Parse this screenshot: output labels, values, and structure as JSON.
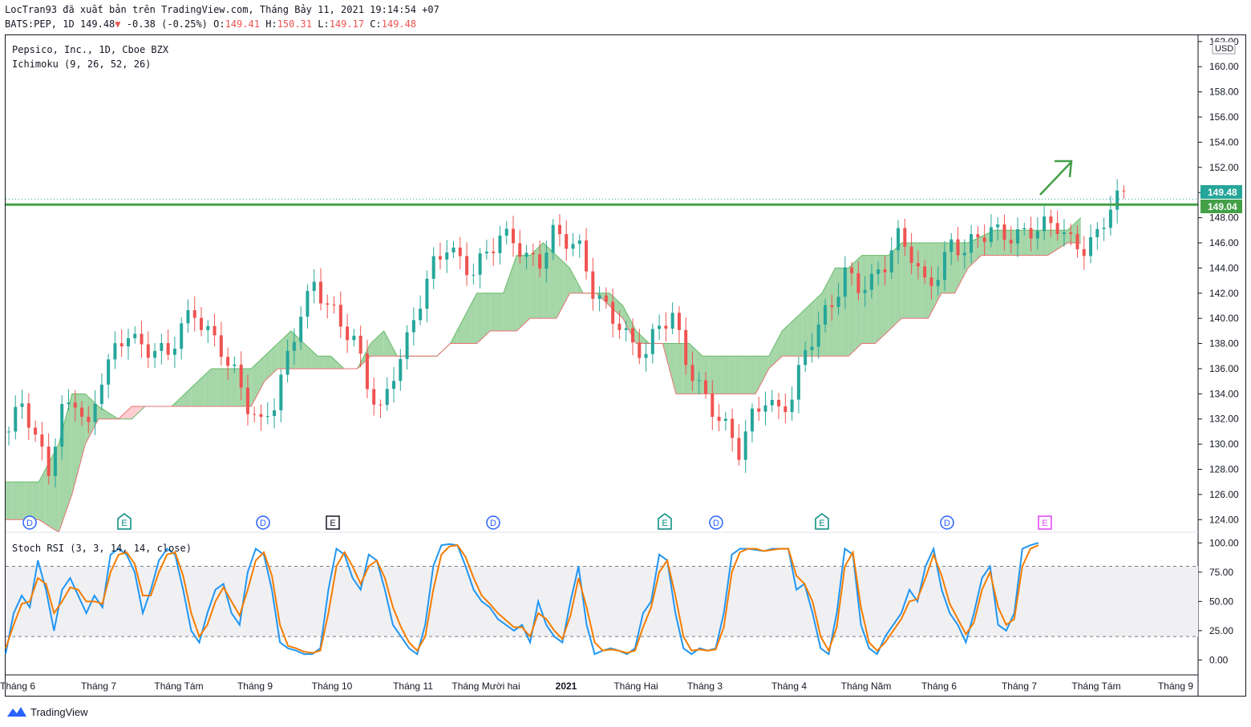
{
  "header": {
    "line1": "LocTran93 đã xuất bản trên TradingView.com, Tháng Bảy 11, 2021 19:14:54 +07",
    "symbol": "BATS:PEP, 1D",
    "last": "149.48",
    "change_arrow": "▼",
    "change": "-0.38 (-0.25%)",
    "o_label": "O:",
    "o_value": "149.41",
    "h_label": "H:",
    "h_value": "150.31",
    "l_label": "L:",
    "l_value": "149.17",
    "c_label": "C:",
    "c_value": "149.48"
  },
  "legend": {
    "title": "Pepsico, Inc., 1D, Cboe BZX",
    "indicator": "Ichimoku (9, 26, 52, 26)",
    "stoch": "Stoch RSI (3, 3, 14, 14, close)"
  },
  "currency": "USD",
  "price_tags": {
    "last": "149.48",
    "level": "149.04"
  },
  "colors": {
    "up": "#26a69a",
    "down": "#ef5350",
    "cloud_up": "#a5d6a7",
    "cloud_down": "#ffcdd2",
    "support": "#43a047",
    "k_line": "#2196f3",
    "d_line": "#f57c00"
  },
  "events": [
    {
      "label": "D",
      "kind": "dividend",
      "x_month": "Tháng 6"
    },
    {
      "label": "E",
      "kind": "earnings",
      "x_month": "Tháng 7"
    },
    {
      "label": "D",
      "kind": "dividend",
      "x_month": "Tháng 9"
    },
    {
      "label": "E",
      "kind": "earnings-dark",
      "x_month": "Tháng 10"
    },
    {
      "label": "D",
      "kind": "dividend",
      "x_month": "Tháng Mười hai"
    },
    {
      "label": "E",
      "kind": "earnings",
      "x_month": "Tháng Hai"
    },
    {
      "label": "D",
      "kind": "dividend",
      "x_month": "Tháng 3"
    },
    {
      "label": "E",
      "kind": "earnings",
      "x_month": "Tháng 4"
    },
    {
      "label": "D",
      "kind": "dividend",
      "x_month": "Tháng 6"
    },
    {
      "label": "E",
      "kind": "earnings-future",
      "x_month": "Tháng 7"
    }
  ],
  "footer": {
    "brand": "TradingView"
  },
  "chart_data": [
    {
      "type": "candlestick",
      "title": "Pepsico, Inc., 1D, Cboe BZX",
      "y_ticks": [
        "162.00",
        "160.00",
        "158.00",
        "156.00",
        "154.00",
        "152.00",
        "150.00",
        "148.00",
        "146.00",
        "144.00",
        "142.00",
        "140.00",
        "138.00",
        "136.00",
        "134.00",
        "132.00",
        "130.00",
        "128.00",
        "126.00",
        "124.00"
      ],
      "ylim": [
        123,
        162.5
      ],
      "x_ticks": [
        "Tháng 6",
        "Tháng 7",
        "Tháng Tám",
        "Tháng 9",
        "Tháng 10",
        "Tháng 11",
        "Tháng Mười hai",
        "2021",
        "Tháng Hai",
        "Tháng 3",
        "Tháng 4",
        "Tháng Năm",
        "Tháng 6",
        "Tháng 7",
        "Tháng Tám",
        "Tháng 9"
      ],
      "support_level": 149.04,
      "last_price": 149.48,
      "price_path": [
        [
          0,
          131
        ],
        [
          2,
          133
        ],
        [
          4,
          130
        ],
        [
          6,
          128
        ],
        [
          8,
          133
        ],
        [
          10,
          134
        ],
        [
          12,
          131
        ],
        [
          14,
          135
        ],
        [
          16,
          137
        ],
        [
          18,
          139
        ],
        [
          20,
          138
        ],
        [
          22,
          138
        ],
        [
          24,
          137
        ],
        [
          26,
          139
        ],
        [
          28,
          140
        ],
        [
          30,
          139
        ],
        [
          32,
          138
        ],
        [
          34,
          136
        ],
        [
          36,
          133
        ],
        [
          38,
          131
        ],
        [
          40,
          133
        ],
        [
          42,
          137
        ],
        [
          44,
          141
        ],
        [
          46,
          143
        ],
        [
          48,
          141
        ],
        [
          50,
          139
        ],
        [
          52,
          138
        ],
        [
          54,
          135
        ],
        [
          56,
          133
        ],
        [
          58,
          136
        ],
        [
          60,
          138
        ],
        [
          62,
          141
        ],
        [
          64,
          144
        ],
        [
          66,
          146
        ],
        [
          68,
          145
        ],
        [
          70,
          144
        ],
        [
          72,
          145
        ],
        [
          74,
          146
        ],
        [
          76,
          146
        ],
        [
          78,
          145
        ],
        [
          80,
          145
        ],
        [
          82,
          147
        ],
        [
          84,
          146
        ],
        [
          86,
          145
        ],
        [
          88,
          142
        ],
        [
          90,
          141
        ],
        [
          92,
          140
        ],
        [
          94,
          138
        ],
        [
          96,
          137
        ],
        [
          98,
          139
        ],
        [
          100,
          140
        ],
        [
          102,
          137
        ],
        [
          104,
          135
        ],
        [
          106,
          133
        ],
        [
          108,
          131
        ],
        [
          110,
          129
        ],
        [
          112,
          132
        ],
        [
          114,
          134
        ],
        [
          116,
          133
        ],
        [
          118,
          134
        ],
        [
          120,
          137
        ],
        [
          122,
          139
        ],
        [
          124,
          141
        ],
        [
          126,
          144
        ],
        [
          128,
          143
        ],
        [
          130,
          143
        ],
        [
          132,
          144
        ],
        [
          134,
          146
        ],
        [
          136,
          145
        ],
        [
          138,
          143
        ],
        [
          140,
          144
        ],
        [
          142,
          146
        ],
        [
          144,
          145
        ],
        [
          146,
          146
        ],
        [
          148,
          147
        ],
        [
          150,
          147
        ],
        [
          152,
          147
        ],
        [
          154,
          147
        ],
        [
          156,
          147
        ],
        [
          158,
          147
        ],
        [
          160,
          146
        ],
        [
          162,
          146
        ],
        [
          164,
          147
        ],
        [
          166,
          149
        ],
        [
          168,
          149.5
        ]
      ],
      "cloud_span_a": [
        [
          0,
          127
        ],
        [
          5,
          127
        ],
        [
          8,
          130
        ],
        [
          10,
          134
        ],
        [
          12,
          134
        ],
        [
          14,
          133
        ],
        [
          17,
          132
        ],
        [
          19,
          132
        ],
        [
          21,
          133
        ],
        [
          23,
          133
        ],
        [
          25,
          133
        ],
        [
          27,
          134
        ],
        [
          29,
          135
        ],
        [
          31,
          136
        ],
        [
          33,
          136
        ],
        [
          35,
          136
        ],
        [
          37,
          136
        ],
        [
          39,
          137
        ],
        [
          41,
          138
        ],
        [
          43,
          139
        ],
        [
          45,
          138
        ],
        [
          47,
          137
        ],
        [
          49,
          137
        ],
        [
          51,
          136
        ],
        [
          53,
          136
        ],
        [
          55,
          138
        ],
        [
          57,
          139
        ],
        [
          59,
          137
        ],
        [
          61,
          137
        ],
        [
          63,
          137
        ],
        [
          65,
          137
        ],
        [
          67,
          138
        ],
        [
          69,
          140
        ],
        [
          71,
          142
        ],
        [
          73,
          142
        ],
        [
          75,
          142
        ],
        [
          77,
          145
        ],
        [
          79,
          145
        ],
        [
          81,
          146
        ],
        [
          83,
          145
        ],
        [
          85,
          144
        ],
        [
          87,
          142
        ],
        [
          89,
          142
        ],
        [
          91,
          142
        ],
        [
          93,
          141
        ],
        [
          95,
          139
        ],
        [
          97,
          138
        ],
        [
          99,
          138
        ],
        [
          101,
          138
        ],
        [
          103,
          138
        ],
        [
          105,
          137
        ],
        [
          107,
          137
        ],
        [
          109,
          137
        ],
        [
          111,
          137
        ],
        [
          113,
          137
        ],
        [
          115,
          137
        ],
        [
          117,
          139
        ],
        [
          119,
          140
        ],
        [
          121,
          141
        ],
        [
          123,
          142
        ],
        [
          125,
          144
        ],
        [
          127,
          144
        ],
        [
          129,
          145
        ],
        [
          131,
          145
        ],
        [
          133,
          145
        ],
        [
          135,
          146
        ],
        [
          137,
          146
        ],
        [
          139,
          146
        ],
        [
          141,
          146
        ],
        [
          143,
          146
        ],
        [
          145,
          146
        ],
        [
          147,
          146.5
        ],
        [
          149,
          147
        ],
        [
          151,
          147
        ],
        [
          153,
          147
        ],
        [
          155,
          147
        ],
        [
          157,
          147
        ],
        [
          160,
          147
        ],
        [
          162,
          148
        ]
      ],
      "cloud_span_b": [
        [
          0,
          124
        ],
        [
          5,
          124
        ],
        [
          8,
          123
        ],
        [
          10,
          126
        ],
        [
          12,
          130
        ],
        [
          14,
          132
        ],
        [
          17,
          132
        ],
        [
          19,
          133
        ],
        [
          21,
          133
        ],
        [
          23,
          133
        ],
        [
          25,
          133
        ],
        [
          27,
          133
        ],
        [
          29,
          133
        ],
        [
          31,
          133
        ],
        [
          33,
          133
        ],
        [
          35,
          133
        ],
        [
          37,
          133
        ],
        [
          39,
          135
        ],
        [
          41,
          136
        ],
        [
          43,
          136
        ],
        [
          45,
          136
        ],
        [
          47,
          136
        ],
        [
          49,
          136
        ],
        [
          51,
          136
        ],
        [
          53,
          136
        ],
        [
          55,
          137
        ],
        [
          57,
          137
        ],
        [
          59,
          137
        ],
        [
          61,
          137
        ],
        [
          63,
          137
        ],
        [
          65,
          137
        ],
        [
          67,
          138
        ],
        [
          69,
          138
        ],
        [
          71,
          138
        ],
        [
          73,
          139
        ],
        [
          75,
          139
        ],
        [
          77,
          139
        ],
        [
          79,
          140
        ],
        [
          81,
          140
        ],
        [
          83,
          140
        ],
        [
          85,
          142
        ],
        [
          87,
          142
        ],
        [
          89,
          142
        ],
        [
          91,
          141
        ],
        [
          93,
          140
        ],
        [
          95,
          138
        ],
        [
          97,
          138
        ],
        [
          99,
          138
        ],
        [
          101,
          134
        ],
        [
          103,
          134
        ],
        [
          105,
          134
        ],
        [
          107,
          134
        ],
        [
          109,
          134
        ],
        [
          111,
          134
        ],
        [
          113,
          134
        ],
        [
          115,
          136
        ],
        [
          117,
          137
        ],
        [
          119,
          137
        ],
        [
          121,
          137
        ],
        [
          123,
          137
        ],
        [
          125,
          137
        ],
        [
          127,
          137
        ],
        [
          129,
          138
        ],
        [
          131,
          138
        ],
        [
          133,
          139
        ],
        [
          135,
          140
        ],
        [
          137,
          140
        ],
        [
          139,
          140
        ],
        [
          141,
          142
        ],
        [
          143,
          142
        ],
        [
          145,
          144
        ],
        [
          147,
          145
        ],
        [
          149,
          145
        ],
        [
          151,
          145
        ],
        [
          153,
          145
        ],
        [
          155,
          145
        ],
        [
          157,
          145
        ],
        [
          160,
          146
        ],
        [
          162,
          146
        ]
      ]
    },
    {
      "type": "line",
      "title": "Stoch RSI (3, 3, 14, 14, close)",
      "y_ticks": [
        "100.00",
        "75.00",
        "50.00",
        "25.00",
        "0.00"
      ],
      "ylim": [
        -10,
        105
      ],
      "bands": [
        20,
        80
      ],
      "series": [
        {
          "values": [
            5,
            40,
            55,
            45,
            85,
            60,
            25,
            60,
            70,
            55,
            40,
            55,
            45,
            90,
            95,
            90,
            75,
            40,
            60,
            85,
            95,
            90,
            60,
            25,
            15,
            40,
            60,
            65,
            40,
            30,
            75,
            95,
            90,
            60,
            15,
            10,
            8,
            5,
            5,
            10,
            60,
            95,
            90,
            70,
            60,
            90,
            85,
            60,
            30,
            20,
            10,
            5,
            30,
            80,
            98,
            99,
            98,
            80,
            60,
            50,
            45,
            35,
            30,
            25,
            30,
            15,
            50,
            30,
            20,
            15,
            50,
            80,
            30,
            5,
            8,
            10,
            8,
            5,
            10,
            40,
            50,
            90,
            85,
            40,
            10,
            5,
            10,
            8,
            10,
            40,
            90,
            95,
            95,
            94,
            93,
            95,
            95,
            95,
            60,
            65,
            40,
            10,
            5,
            40,
            95,
            90,
            30,
            10,
            5,
            20,
            30,
            40,
            60,
            50,
            80,
            95,
            60,
            40,
            30,
            15,
            40,
            70,
            80,
            30,
            25,
            40,
            95,
            98,
            100
          ]
        },
        {
          "values": [
            10,
            30,
            48,
            50,
            70,
            65,
            40,
            50,
            62,
            60,
            50,
            50,
            48,
            75,
            90,
            92,
            82,
            55,
            55,
            75,
            90,
            92,
            72,
            40,
            20,
            30,
            50,
            62,
            50,
            38,
            60,
            85,
            92,
            72,
            30,
            12,
            10,
            7,
            6,
            8,
            40,
            80,
            92,
            80,
            65,
            80,
            85,
            70,
            45,
            28,
            15,
            8,
            20,
            60,
            90,
            97,
            98,
            88,
            70,
            55,
            48,
            40,
            34,
            28,
            28,
            20,
            40,
            35,
            25,
            18,
            38,
            70,
            45,
            15,
            8,
            9,
            8,
            6,
            8,
            28,
            45,
            75,
            85,
            55,
            20,
            8,
            9,
            8,
            9,
            28,
            75,
            92,
            95,
            95,
            93,
            94,
            95,
            95,
            72,
            65,
            50,
            20,
            8,
            28,
            80,
            92,
            45,
            15,
            8,
            15,
            25,
            35,
            50,
            52,
            70,
            90,
            72,
            48,
            35,
            22,
            32,
            60,
            75,
            45,
            30,
            35,
            80,
            95,
            98
          ]
        }
      ]
    }
  ]
}
